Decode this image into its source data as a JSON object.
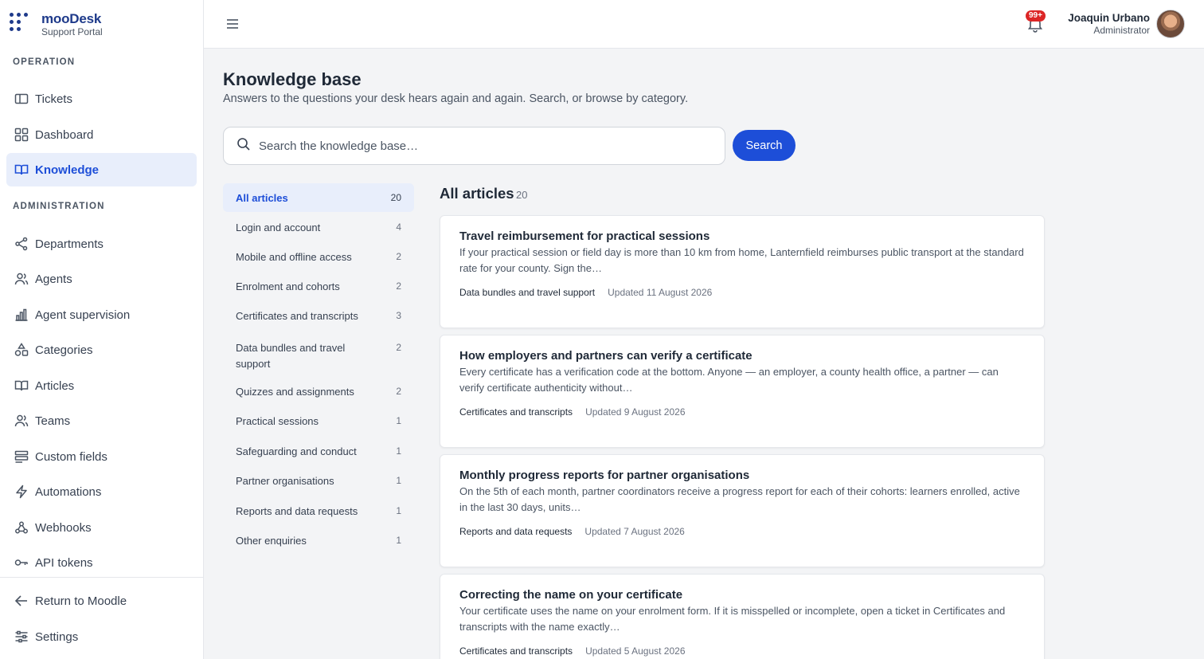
{
  "brand": {
    "name": "mooDesk",
    "subtitle": "Support Portal"
  },
  "sidebar": {
    "operation_label": "OPERATION",
    "administration_label": "ADMINISTRATION",
    "operation_items": [
      {
        "label": "Tickets",
        "icon": "ticket-icon"
      },
      {
        "label": "Dashboard",
        "icon": "dashboard-icon"
      },
      {
        "label": "Knowledge",
        "icon": "book-icon",
        "active": true
      }
    ],
    "admin_items": [
      {
        "label": "Departments",
        "icon": "share-icon"
      },
      {
        "label": "Agents",
        "icon": "users-icon"
      },
      {
        "label": "Agent supervision",
        "icon": "bar-chart-icon"
      },
      {
        "label": "Categories",
        "icon": "shapes-icon"
      },
      {
        "label": "Articles",
        "icon": "book-icon"
      },
      {
        "label": "Teams",
        "icon": "users-icon"
      },
      {
        "label": "Custom fields",
        "icon": "fields-icon"
      },
      {
        "label": "Automations",
        "icon": "bolt-icon"
      },
      {
        "label": "Webhooks",
        "icon": "webhook-icon"
      },
      {
        "label": "API tokens",
        "icon": "key-icon"
      }
    ],
    "footer_items": [
      {
        "label": "Return to Moodle",
        "icon": "arrow-left-icon"
      },
      {
        "label": "Settings",
        "icon": "sliders-icon"
      }
    ]
  },
  "topbar": {
    "notification_badge": "99+",
    "user_name": "Joaquin Urbano",
    "user_role": "Administrator"
  },
  "main": {
    "title": "Knowledge base",
    "subtitle": "Answers to the questions your desk hears again and again. Search, or browse by category.",
    "search_placeholder": "Search the knowledge base…",
    "search_button": "Search",
    "categories": [
      {
        "label": "All articles",
        "count": "20",
        "active": true
      },
      {
        "label": "Login and account",
        "count": "4"
      },
      {
        "label": "Mobile and offline access",
        "count": "2"
      },
      {
        "label": "Enrolment and cohorts",
        "count": "2"
      },
      {
        "label": "Certificates and transcripts",
        "count": "3"
      },
      {
        "label": "Data bundles and travel support",
        "count": "2"
      },
      {
        "label": "Quizzes and assignments",
        "count": "2"
      },
      {
        "label": "Practical sessions",
        "count": "1"
      },
      {
        "label": "Safeguarding and conduct",
        "count": "1"
      },
      {
        "label": "Partner organisations",
        "count": "1"
      },
      {
        "label": "Reports and data requests",
        "count": "1"
      },
      {
        "label": "Other enquiries",
        "count": "1"
      }
    ],
    "articles_heading": "All articles",
    "articles_count": "20",
    "articles": [
      {
        "title": "Travel reimbursement for practical sessions",
        "excerpt": "If your practical session or field day is more than 10 km from home, Lanternfield reimburses public transport at the standard rate for your county. Sign the…",
        "category": "Data bundles and travel support",
        "updated": "Updated 11 August 2026"
      },
      {
        "title": "How employers and partners can verify a certificate",
        "excerpt": "Every certificate has a verification code at the bottom. Anyone — an employer, a county health office, a partner — can verify certificate authenticity without…",
        "category": "Certificates and transcripts",
        "updated": "Updated 9 August 2026"
      },
      {
        "title": "Monthly progress reports for partner organisations",
        "excerpt": "On the 5th of each month, partner coordinators receive a progress report for each of their cohorts: learners enrolled, active in the last 30 days, units…",
        "category": "Reports and data requests",
        "updated": "Updated 7 August 2026"
      },
      {
        "title": "Correcting the name on your certificate",
        "excerpt": "Your certificate uses the name on your enrolment form. If it is misspelled or incomplete, open a ticket in Certificates and transcripts with the name exactly…",
        "category": "Certificates and transcripts",
        "updated": "Updated 5 August 2026"
      }
    ]
  }
}
